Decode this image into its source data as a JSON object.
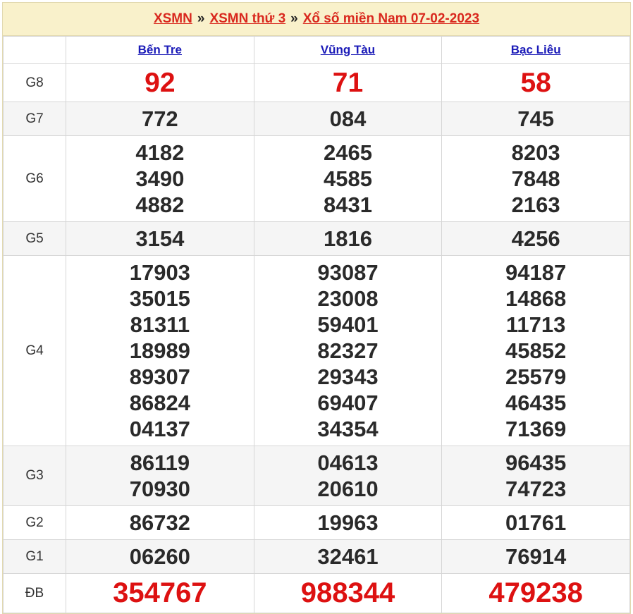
{
  "breadcrumb": {
    "items": [
      "XSMN",
      "XSMN thứ 3",
      "Xổ số miền Nam 07-02-2023"
    ],
    "separator": "»"
  },
  "provinces": [
    "Bến Tre",
    "Vũng Tàu",
    "Bạc Liêu"
  ],
  "prizes": [
    {
      "label": "G8",
      "results": [
        [
          "92"
        ],
        [
          "71"
        ],
        [
          "58"
        ]
      ]
    },
    {
      "label": "G7",
      "results": [
        [
          "772"
        ],
        [
          "084"
        ],
        [
          "745"
        ]
      ]
    },
    {
      "label": "G6",
      "results": [
        [
          "4182",
          "3490",
          "4882"
        ],
        [
          "2465",
          "4585",
          "8431"
        ],
        [
          "8203",
          "7848",
          "2163"
        ]
      ]
    },
    {
      "label": "G5",
      "results": [
        [
          "3154"
        ],
        [
          "1816"
        ],
        [
          "4256"
        ]
      ]
    },
    {
      "label": "G4",
      "results": [
        [
          "17903",
          "35015",
          "81311",
          "18989",
          "89307",
          "86824",
          "04137"
        ],
        [
          "93087",
          "23008",
          "59401",
          "82327",
          "29343",
          "69407",
          "34354"
        ],
        [
          "94187",
          "14868",
          "11713",
          "45852",
          "25579",
          "46435",
          "71369"
        ]
      ]
    },
    {
      "label": "G3",
      "results": [
        [
          "86119",
          "70930"
        ],
        [
          "04613",
          "20610"
        ],
        [
          "96435",
          "74723"
        ]
      ]
    },
    {
      "label": "G2",
      "results": [
        [
          "86732"
        ],
        [
          "19963"
        ],
        [
          "01761"
        ]
      ]
    },
    {
      "label": "G1",
      "results": [
        [
          "06260"
        ],
        [
          "32461"
        ],
        [
          "76914"
        ]
      ]
    },
    {
      "label": "ĐB",
      "results": [
        [
          "354767"
        ],
        [
          "988344"
        ],
        [
          "479238"
        ]
      ]
    }
  ],
  "colors": {
    "link": "#d9281e",
    "province_link": "#1b1bb8",
    "special": "#dd1111",
    "header_bg": "#f9f1cb"
  }
}
